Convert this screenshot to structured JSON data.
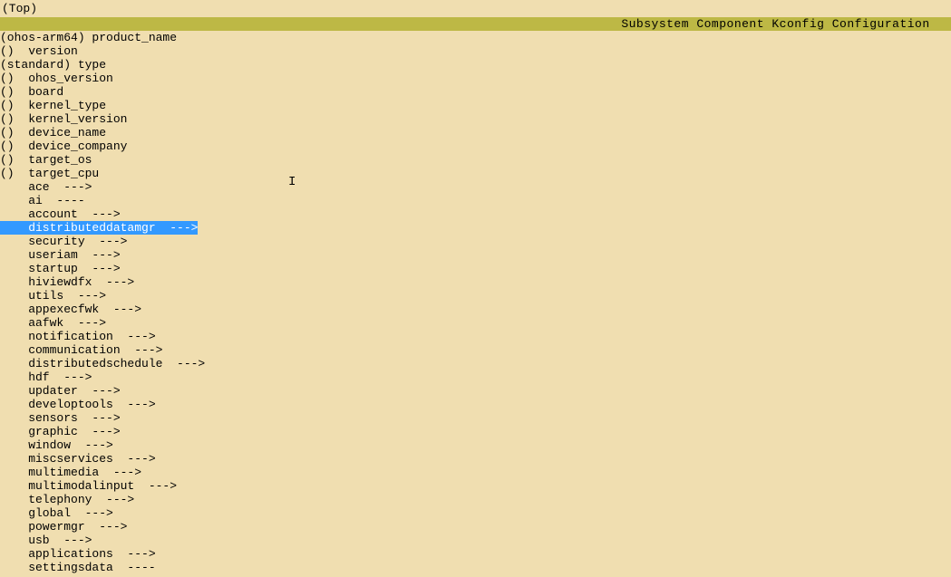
{
  "top_label": "(Top)",
  "title": "Subsystem Component Kconfig Configuration",
  "config_lines": [
    {
      "prefix": "(ohos-arm64) ",
      "name": "product_name",
      "suffix": ""
    },
    {
      "prefix": "()  ",
      "name": "version",
      "suffix": ""
    },
    {
      "prefix": "(standard) ",
      "name": "type",
      "suffix": ""
    },
    {
      "prefix": "()  ",
      "name": "ohos_version",
      "suffix": ""
    },
    {
      "prefix": "()  ",
      "name": "board",
      "suffix": ""
    },
    {
      "prefix": "()  ",
      "name": "kernel_type",
      "suffix": ""
    },
    {
      "prefix": "()  ",
      "name": "kernel_version",
      "suffix": ""
    },
    {
      "prefix": "()  ",
      "name": "device_name",
      "suffix": ""
    },
    {
      "prefix": "()  ",
      "name": "device_company",
      "suffix": ""
    },
    {
      "prefix": "()  ",
      "name": "target_os",
      "suffix": ""
    },
    {
      "prefix": "()  ",
      "name": "target_cpu",
      "suffix": ""
    },
    {
      "prefix": "    ",
      "name": "ace",
      "suffix": "  --->"
    },
    {
      "prefix": "    ",
      "name": "ai",
      "suffix": "  ----"
    },
    {
      "prefix": "    ",
      "name": "account",
      "suffix": "  --->"
    },
    {
      "prefix": "    ",
      "name": "distributeddatamgr",
      "suffix": "  --->",
      "selected": true
    },
    {
      "prefix": "    ",
      "name": "security",
      "suffix": "  --->"
    },
    {
      "prefix": "    ",
      "name": "useriam",
      "suffix": "  --->"
    },
    {
      "prefix": "    ",
      "name": "startup",
      "suffix": "  --->"
    },
    {
      "prefix": "    ",
      "name": "hiviewdfx",
      "suffix": "  --->"
    },
    {
      "prefix": "    ",
      "name": "utils",
      "suffix": "  --->"
    },
    {
      "prefix": "    ",
      "name": "appexecfwk",
      "suffix": "  --->"
    },
    {
      "prefix": "    ",
      "name": "aafwk",
      "suffix": "  --->"
    },
    {
      "prefix": "    ",
      "name": "notification",
      "suffix": "  --->"
    },
    {
      "prefix": "    ",
      "name": "communication",
      "suffix": "  --->"
    },
    {
      "prefix": "    ",
      "name": "distributedschedule",
      "suffix": "  --->"
    },
    {
      "prefix": "    ",
      "name": "hdf",
      "suffix": "  --->"
    },
    {
      "prefix": "    ",
      "name": "updater",
      "suffix": "  --->"
    },
    {
      "prefix": "    ",
      "name": "developtools",
      "suffix": "  --->"
    },
    {
      "prefix": "    ",
      "name": "sensors",
      "suffix": "  --->"
    },
    {
      "prefix": "    ",
      "name": "graphic",
      "suffix": "  --->"
    },
    {
      "prefix": "    ",
      "name": "window",
      "suffix": "  --->"
    },
    {
      "prefix": "    ",
      "name": "miscservices",
      "suffix": "  --->"
    },
    {
      "prefix": "    ",
      "name": "multimedia",
      "suffix": "  --->"
    },
    {
      "prefix": "    ",
      "name": "multimodalinput",
      "suffix": "  --->"
    },
    {
      "prefix": "    ",
      "name": "telephony",
      "suffix": "  --->"
    },
    {
      "prefix": "    ",
      "name": "global",
      "suffix": "  --->"
    },
    {
      "prefix": "    ",
      "name": "powermgr",
      "suffix": "  --->"
    },
    {
      "prefix": "    ",
      "name": "usb",
      "suffix": "  --->"
    },
    {
      "prefix": "    ",
      "name": "applications",
      "suffix": "  --->"
    },
    {
      "prefix": "    ",
      "name": "settingsdata",
      "suffix": "  ----"
    }
  ],
  "cursor_char": "I",
  "colors": {
    "background": "#f0deb0",
    "title_bar": "#bdb845",
    "selection": "#3399ff"
  }
}
